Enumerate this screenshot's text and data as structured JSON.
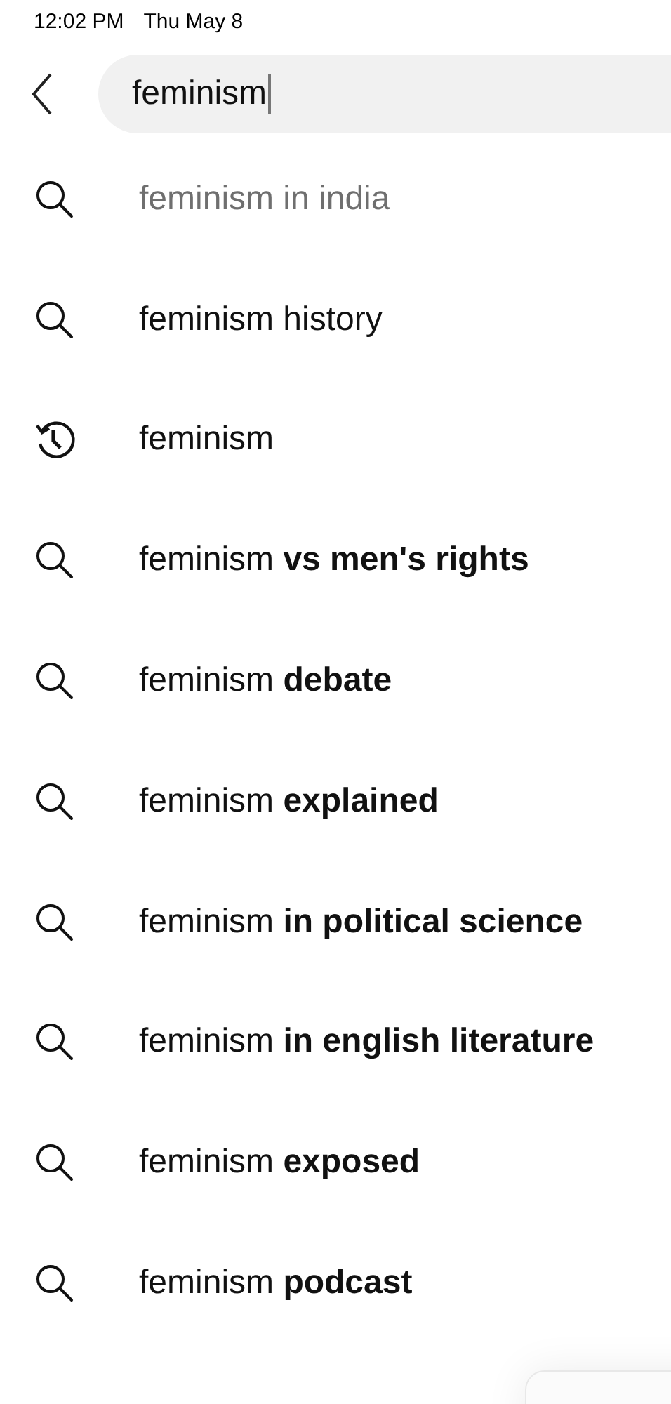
{
  "status_bar": {
    "time": "12:02 PM",
    "date": "Thu May 8"
  },
  "search": {
    "value": "feminism"
  },
  "suggestions": [
    {
      "kind": "search",
      "text": "feminism in india",
      "dimmed": true
    },
    {
      "kind": "search",
      "text": "feminism history",
      "dimmed": false
    },
    {
      "kind": "history",
      "text": "feminism",
      "dimmed": false
    },
    {
      "kind": "search",
      "text": "feminism **vs men's rights**",
      "dimmed": false
    },
    {
      "kind": "search",
      "text": "feminism **debate**",
      "dimmed": false
    },
    {
      "kind": "search",
      "text": "feminism **explained**",
      "dimmed": false
    },
    {
      "kind": "search",
      "text": "feminism **in political science**",
      "dimmed": false
    },
    {
      "kind": "search",
      "text": "feminism **in english literature**",
      "dimmed": false
    },
    {
      "kind": "search",
      "text": "feminism **exposed**",
      "dimmed": false
    },
    {
      "kind": "search",
      "text": "feminism **podcast**",
      "dimmed": false
    }
  ]
}
